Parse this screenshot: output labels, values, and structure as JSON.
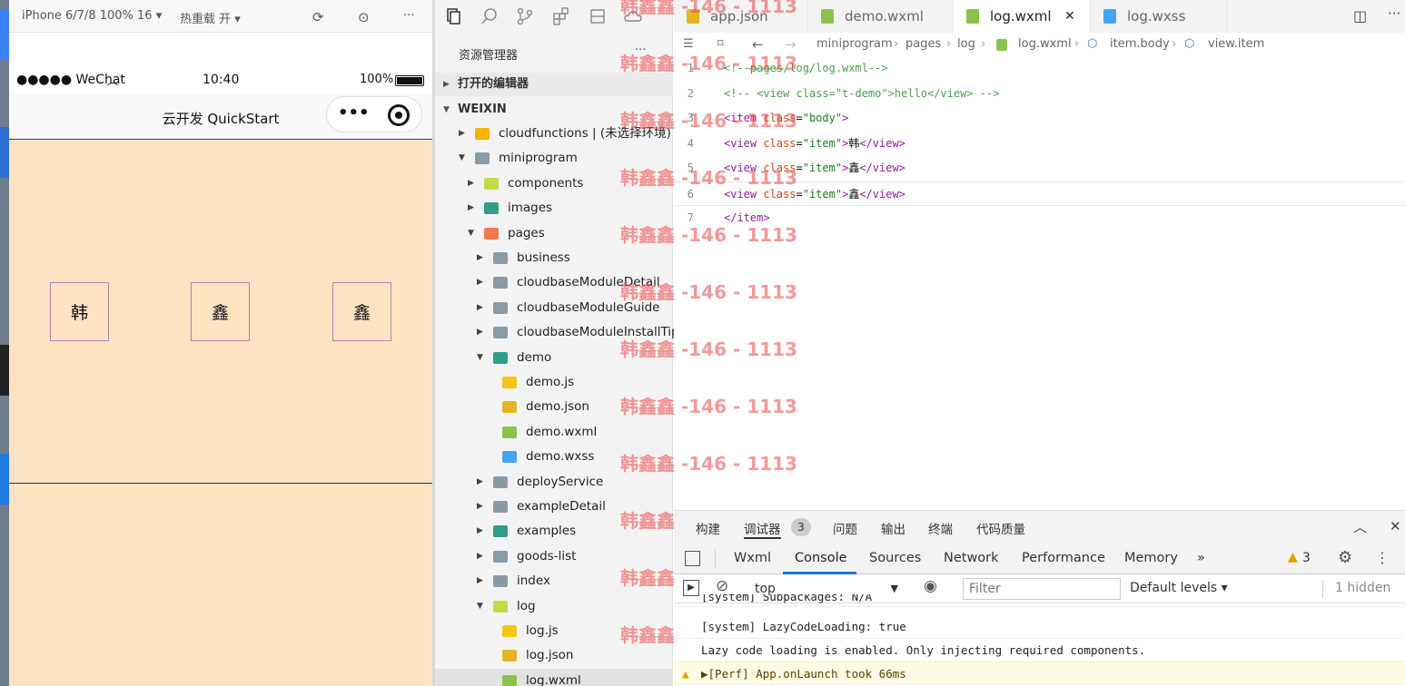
{
  "simulator": {
    "device_label": "iPhone 6/7/8 100% 16",
    "hot_reload": "热重载 开",
    "status": {
      "carrier": "●●●●● WeChat",
      "time": "10:40",
      "battery": "100%"
    },
    "nav_title": "云开发 QuickStart",
    "capsule_more": "•••",
    "items": [
      "韩",
      "鑫",
      "鑫"
    ]
  },
  "explorer": {
    "title": "资源管理器",
    "more": "···",
    "open_editors": "打开的编辑器",
    "workspace": "WEIXIN",
    "tree": [
      {
        "label": "cloudfunctions | (未选择环境)",
        "depth": 0,
        "arrow": "▶",
        "color": "#f4b400"
      },
      {
        "label": "miniprogram",
        "depth": 0,
        "arrow": "▼",
        "color": "#8a9ba8"
      },
      {
        "label": "components",
        "depth": 1,
        "arrow": "▶",
        "color": "#c5d84a"
      },
      {
        "label": "images",
        "depth": 1,
        "arrow": "▶",
        "color": "#2f9e8c"
      },
      {
        "label": "pages",
        "depth": 1,
        "arrow": "▼",
        "color": "#f07b50"
      },
      {
        "label": "business",
        "depth": 2,
        "arrow": "▶",
        "color": "#8a9ba8"
      },
      {
        "label": "cloudbaseModuleDetail",
        "depth": 2,
        "arrow": "▶",
        "color": "#8a9ba8"
      },
      {
        "label": "cloudbaseModuleGuide",
        "depth": 2,
        "arrow": "▶",
        "color": "#8a9ba8"
      },
      {
        "label": "cloudbaseModuleInstallTips",
        "depth": 2,
        "arrow": "▶",
        "color": "#8a9ba8"
      },
      {
        "label": "demo",
        "depth": 2,
        "arrow": "▼",
        "color": "#2f9e8c"
      },
      {
        "label": "demo.js",
        "depth": 3,
        "arrow": "",
        "color": "#f5c518"
      },
      {
        "label": "demo.json",
        "depth": 3,
        "arrow": "",
        "color": "#e6b422"
      },
      {
        "label": "demo.wxml",
        "depth": 3,
        "arrow": "",
        "color": "#8bc34a"
      },
      {
        "label": "demo.wxss",
        "depth": 3,
        "arrow": "",
        "color": "#42a5f5"
      },
      {
        "label": "deployService",
        "depth": 2,
        "arrow": "▶",
        "color": "#8a9ba8"
      },
      {
        "label": "exampleDetail",
        "depth": 2,
        "arrow": "▶",
        "color": "#8a9ba8"
      },
      {
        "label": "examples",
        "depth": 2,
        "arrow": "▶",
        "color": "#2f9e8c"
      },
      {
        "label": "goods-list",
        "depth": 2,
        "arrow": "▶",
        "color": "#8a9ba8"
      },
      {
        "label": "index",
        "depth": 2,
        "arrow": "▶",
        "color": "#8a9ba8"
      },
      {
        "label": "log",
        "depth": 2,
        "arrow": "▼",
        "color": "#c5d84a"
      },
      {
        "label": "log.js",
        "depth": 3,
        "arrow": "",
        "color": "#f5c518"
      },
      {
        "label": "log.json",
        "depth": 3,
        "arrow": "",
        "color": "#e6b422"
      },
      {
        "label": "log.wxml",
        "depth": 3,
        "arrow": "",
        "color": "#8bc34a"
      }
    ]
  },
  "editor": {
    "tabs": [
      {
        "label": "app.json",
        "color": "#e6b422",
        "active": false
      },
      {
        "label": "demo.wxml",
        "color": "#8bc34a",
        "active": false
      },
      {
        "label": "log.wxml",
        "color": "#8bc34a",
        "active": true
      },
      {
        "label": "log.wxss",
        "color": "#42a5f5",
        "active": false
      }
    ],
    "close_glyph": "✕",
    "breadcrumb": [
      "miniprogram",
      "pages",
      "log",
      "log.wxml",
      "item.body",
      "view.item"
    ],
    "code": [
      {
        "n": "1",
        "parts": [
          {
            "c": "c-com",
            "t": "<!--pages/log/log.wxml-->"
          }
        ]
      },
      {
        "n": "2",
        "parts": [
          {
            "c": "c-com",
            "t": "<!-- <view class=\"t-demo\">hello</view> -->"
          }
        ]
      },
      {
        "n": "3",
        "parts": [
          {
            "c": "c-tag",
            "t": "<item "
          },
          {
            "c": "c-attr",
            "t": "class"
          },
          {
            "c": "c-txt",
            "t": "="
          },
          {
            "c": "c-str",
            "t": "\"body\""
          },
          {
            "c": "c-tag",
            "t": ">"
          }
        ]
      },
      {
        "n": "4",
        "parts": [
          {
            "c": "c-tag",
            "t": "<view "
          },
          {
            "c": "c-attr",
            "t": "class"
          },
          {
            "c": "c-txt",
            "t": "="
          },
          {
            "c": "c-str",
            "t": "\"item\""
          },
          {
            "c": "c-tag",
            "t": ">"
          },
          {
            "c": "c-txt",
            "t": "韩"
          },
          {
            "c": "c-tag",
            "t": "</view>"
          }
        ]
      },
      {
        "n": "5",
        "parts": [
          {
            "c": "c-tag",
            "t": "<view "
          },
          {
            "c": "c-attr",
            "t": "class"
          },
          {
            "c": "c-txt",
            "t": "="
          },
          {
            "c": "c-str",
            "t": "\"item\""
          },
          {
            "c": "c-tag",
            "t": ">"
          },
          {
            "c": "c-txt",
            "t": "鑫"
          },
          {
            "c": "c-tag",
            "t": "</view>"
          }
        ]
      },
      {
        "n": "6",
        "parts": [
          {
            "c": "c-tag",
            "t": "<view "
          },
          {
            "c": "c-attr",
            "t": "class"
          },
          {
            "c": "c-txt",
            "t": "="
          },
          {
            "c": "c-str",
            "t": "\"item\""
          },
          {
            "c": "c-tag",
            "t": ">"
          },
          {
            "c": "c-txt",
            "t": "鑫"
          },
          {
            "c": "c-tag",
            "t": "</view>"
          }
        ]
      },
      {
        "n": "7",
        "parts": [
          {
            "c": "c-tag",
            "t": "</item>"
          }
        ]
      }
    ]
  },
  "watermark": "韩鑫鑫 -146 - 1113",
  "devtools": {
    "top_tabs": [
      "构建",
      "调试器",
      "问题",
      "输出",
      "终端",
      "代码质量"
    ],
    "badge": "3",
    "tabs": [
      "Wxml",
      "Console",
      "Sources",
      "Network",
      "Performance",
      "Memory"
    ],
    "more_tabs": "»",
    "warn_count": "3",
    "context": "top",
    "filter_placeholder": "Filter",
    "levels": "Default levels ▾",
    "hidden": "1 hidden",
    "logs": [
      {
        "text": "[system] Subpackages: N/A",
        "warn": false
      },
      {
        "text": "[system] LazyCodeLoading: true",
        "warn": false
      },
      {
        "text": "Lazy code loading is enabled. Only injecting required components.",
        "warn": false
      },
      {
        "text": "▶[Perf] App.onLaunch took 66ms",
        "warn": true
      }
    ]
  }
}
